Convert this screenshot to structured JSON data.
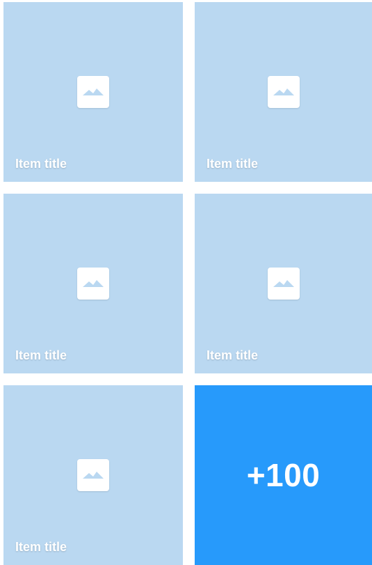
{
  "grid": {
    "items": [
      {
        "title": "Item title",
        "icon": "image-placeholder-icon"
      },
      {
        "title": "Item title",
        "icon": "image-placeholder-icon"
      },
      {
        "title": "Item title",
        "icon": "image-placeholder-icon"
      },
      {
        "title": "Item title",
        "icon": "image-placeholder-icon"
      },
      {
        "title": "Item title",
        "icon": "image-placeholder-icon"
      }
    ],
    "more": {
      "label": "+100"
    }
  },
  "colors": {
    "tile_background": "#bad8f1",
    "more_tile_background": "#279afb",
    "icon_background": "#ffffff",
    "icon_mountain": "#bad8f1",
    "text": "#ffffff"
  }
}
